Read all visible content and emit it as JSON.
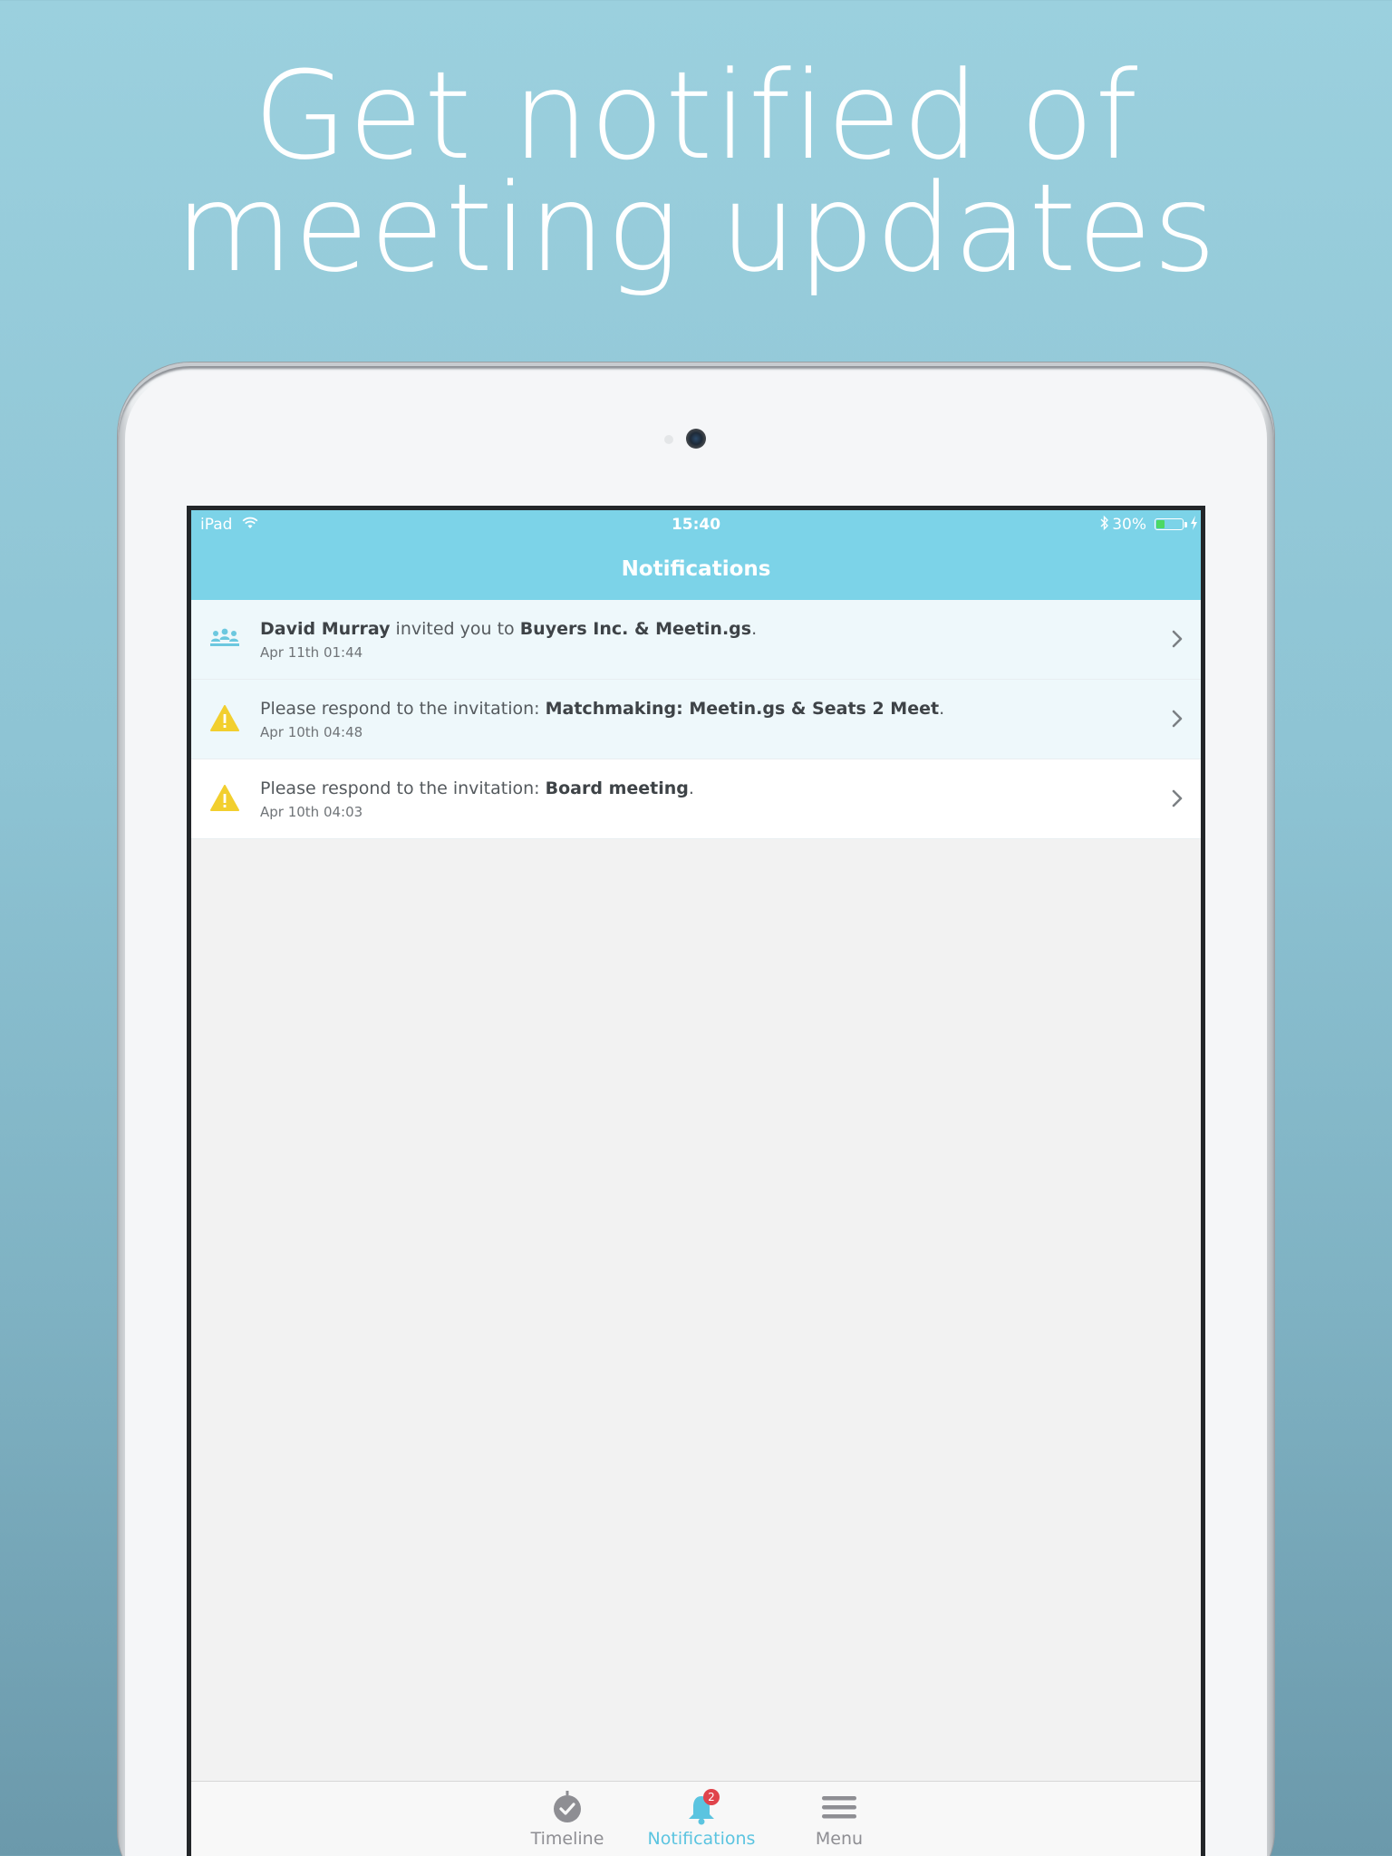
{
  "headline": {
    "line1": "Get notified of",
    "line2": "meeting updates"
  },
  "status_bar": {
    "carrier": "iPad",
    "time": "15:40",
    "battery_pct": "30%"
  },
  "nav": {
    "title": "Notifications"
  },
  "notifications": [
    {
      "icon": "people-icon",
      "pre": "",
      "bold1": "David Murray",
      "mid": " invited you to ",
      "bold2": "Buyers Inc. & Meetin.gs",
      "post": ".",
      "date": "Apr 11th 01:44",
      "state": "unread"
    },
    {
      "icon": "warning-icon",
      "pre": "Please respond to the invitation: ",
      "bold1": "",
      "mid": "",
      "bold2": "Matchmaking: Meetin.gs & Seats 2 Meet",
      "post": ".",
      "date": "Apr 10th 04:48",
      "state": "unread"
    },
    {
      "icon": "warning-icon",
      "pre": "Please respond to the invitation: ",
      "bold1": "",
      "mid": "",
      "bold2": "Board meeting",
      "post": ".",
      "date": "Apr 10th 04:03",
      "state": "read"
    }
  ],
  "tabbar": {
    "timeline": "Timeline",
    "notifications": "Notifications",
    "notifications_badge": "2",
    "menu": "Menu",
    "active_color": "#5bc4e0",
    "inactive_color": "#8e8e93"
  },
  "colors": {
    "nav_bg": "#7cd3e8",
    "warning": "#f2cf2e",
    "people": "#6cc8df",
    "badge": "#e0434b"
  }
}
